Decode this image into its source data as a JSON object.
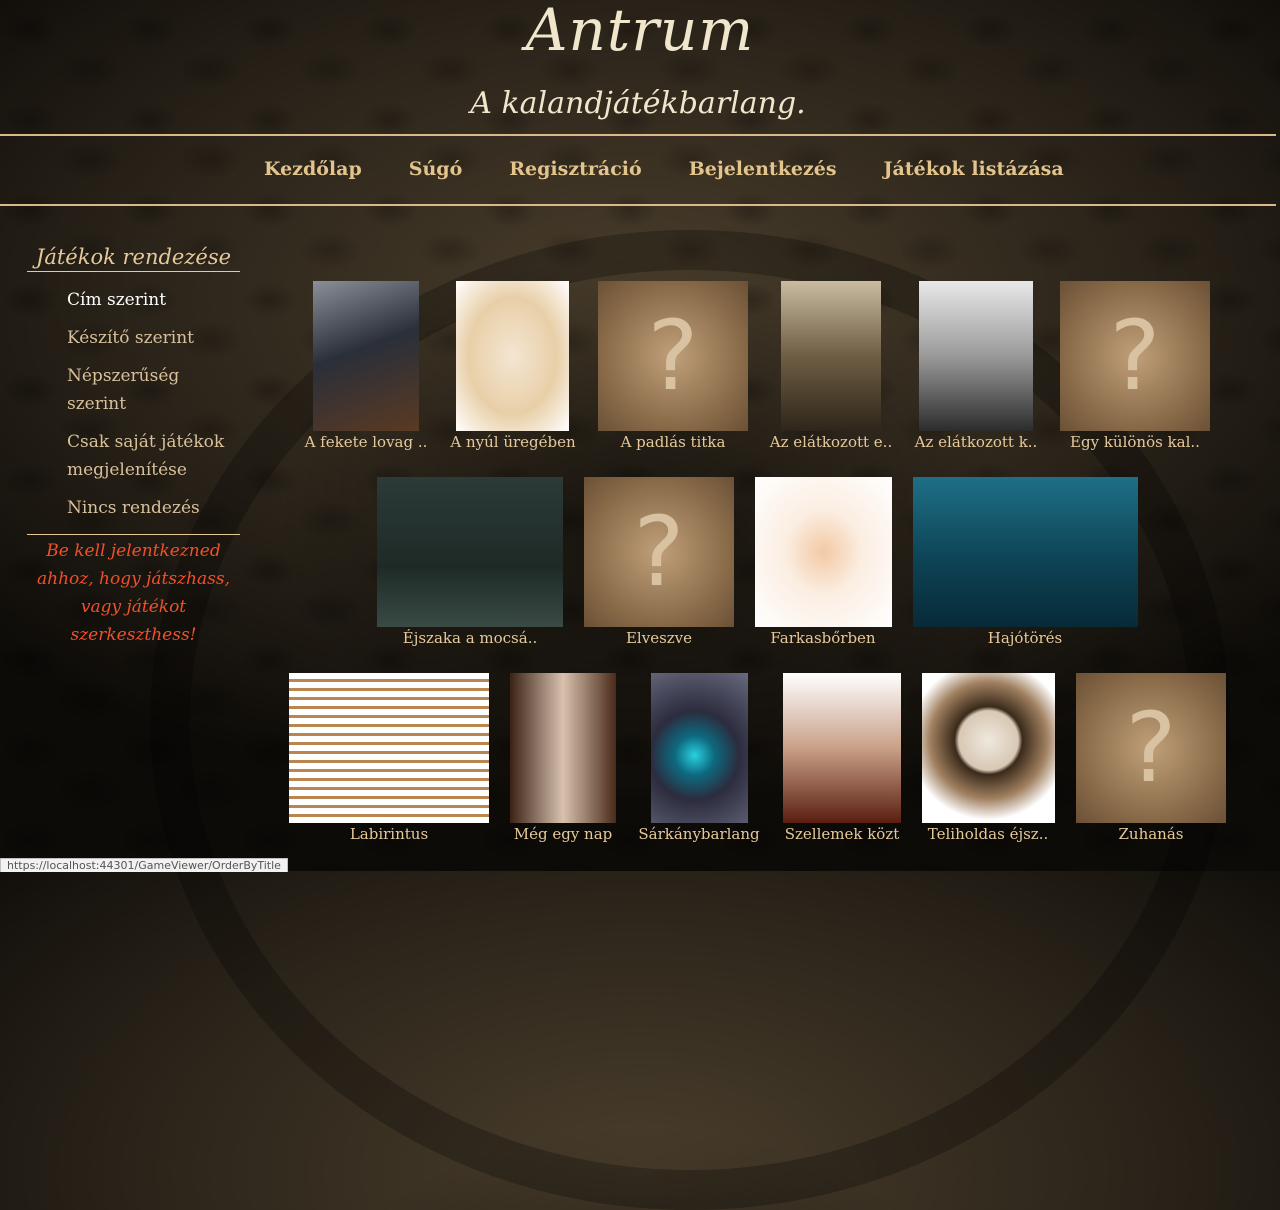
{
  "header": {
    "title": "Antrum",
    "subtitle": "A kalandjátékbarlang."
  },
  "nav": {
    "items": [
      "Kezdőlap",
      "Súgó",
      "Regisztráció",
      "Bejelentkezés",
      "Játékok listázása"
    ]
  },
  "sidebar": {
    "title": "Játékok rendezése",
    "items": [
      "Cím szerint",
      "Készítő szerint",
      "Népszerűség szerint",
      "Csak saját játékok megjelenítése",
      "Nincs rendezés"
    ],
    "active_item": "Cím szerint",
    "warning": "Be kell jelentkezned ahhoz, hogy játszhass, vagy játékot szerkeszthess!"
  },
  "games": [
    {
      "title": "A fekete lovag ..",
      "image": "knight-painting"
    },
    {
      "title": "A nyúl üregében",
      "image": "rabbit-sketch"
    },
    {
      "title": "A padlás titka",
      "image": "question-placeholder"
    },
    {
      "title": "Az elátkozott e..",
      "image": "forest-painting"
    },
    {
      "title": "Az elátkozott k..",
      "image": "castle-sketch"
    },
    {
      "title": "Egy különös kal..",
      "image": "question-placeholder"
    },
    {
      "title": "Éjszaka a mocsá..",
      "image": "swamp-painting"
    },
    {
      "title": "Elveszve",
      "image": "question-placeholder"
    },
    {
      "title": "Farkasbőrben",
      "image": "wolf-sketch"
    },
    {
      "title": "Hajótörés",
      "image": "shipwreck-painting"
    },
    {
      "title": "Labirintus",
      "image": "maze-sketch"
    },
    {
      "title": "Még egy nap",
      "image": "city-painting"
    },
    {
      "title": "Sárkánybarlang",
      "image": "dragon-eye-painting"
    },
    {
      "title": "Szellemek közt",
      "image": "gate-sketch"
    },
    {
      "title": "Teliholdas éjsz..",
      "image": "moon-painting"
    },
    {
      "title": "Zuhanás",
      "image": "question-placeholder"
    }
  ],
  "placeholder_glyph": "?",
  "status_bar": {
    "url": "https://localhost:44301/GameViewer/OrderByTitle"
  }
}
